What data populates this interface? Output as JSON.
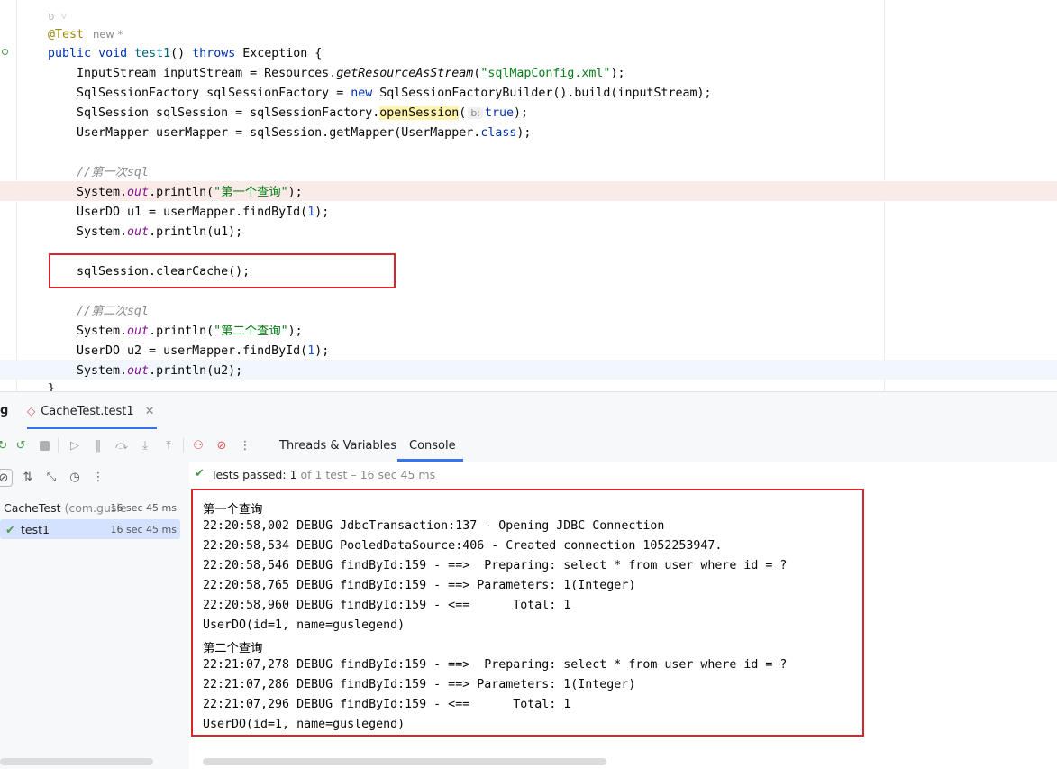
{
  "editor": {
    "author_hint": "ʋ",
    "annotation": "@Test",
    "annotation_meta": "new *",
    "lines": {
      "sig_kw1": "public",
      "sig_kw2": "void",
      "sig_name": "test1",
      "sig_rest": "() ",
      "sig_kw3": "throws",
      "sig_tail": " Exception {",
      "l1_a": "InputStream inputStream = Resources.",
      "l1_b": "getResourceAsStream",
      "l1_c": "(",
      "l1_d": "\"sqlMapConfig.xml\"",
      "l1_e": ");",
      "l2_a": "SqlSessionFactory sqlSessionFactory = ",
      "l2_b": "new",
      "l2_c": " SqlSessionFactoryBuilder().build(inputStream);",
      "l3_a": "SqlSession sqlSession = sqlSessionFactory.",
      "l3_b": "openSession",
      "l3_c": "(",
      "l3_hint": "b:",
      "l3_d": "true",
      "l3_e": ");",
      "l4_a": "UserMapper userMapper = sqlSession.getMapper(UserMapper.",
      "l4_b": "class",
      "l4_c": ");",
      "c1": "//第一次sql",
      "l5_a": "System.",
      "l5_b": "out",
      "l5_c": ".println(",
      "l5_d": "\"第一个查询\"",
      "l5_e": ");",
      "l6_a": "UserDO u1 = userMapper.findById(",
      "l6_b": "1",
      "l6_c": ");",
      "l7_a": "System.",
      "l7_b": "out",
      "l7_c": ".println(u1);",
      "l8": "sqlSession.clearCache();",
      "c2": "//第二次sql",
      "l9_a": "System.",
      "l9_b": "out",
      "l9_c": ".println(",
      "l9_d": "\"第二个查询\"",
      "l9_e": ");",
      "l10_a": "UserDO u2 = userMapper.findById(",
      "l10_b": "1",
      "l10_c": ");",
      "l11_a": "System.",
      "l11_b": "out",
      "l11_c": ".println(u2);",
      "close": "}"
    }
  },
  "debug_panel": {
    "tool_label": "g",
    "run_tab_label": "CacheTest.test1",
    "subtabs": [
      "Threads & Variables",
      "Console"
    ],
    "active_subtab": "Console",
    "status_text_prefix": "Tests passed: ",
    "status_count": "1",
    "status_suffix": " of 1 test – 16 sec 45 ms",
    "tree": [
      {
        "label": "CacheTest",
        "sub": "(com.gusle",
        "duration": "16 sec 45 ms"
      },
      {
        "label": "test1",
        "duration": "16 sec 45 ms"
      }
    ]
  },
  "console_lines": [
    "第一个查询",
    "22:20:58,002 DEBUG JdbcTransaction:137 - Opening JDBC Connection",
    "22:20:58,534 DEBUG PooledDataSource:406 - Created connection 1052253947.",
    "22:20:58,546 DEBUG findById:159 - ==>  Preparing: select * from user where id = ?",
    "22:20:58,765 DEBUG findById:159 - ==> Parameters: 1(Integer)",
    "22:20:58,960 DEBUG findById:159 - <==      Total: 1",
    "UserDO(id=1, name=guslegend)",
    "第二个查询",
    "22:21:07,278 DEBUG findById:159 - ==>  Preparing: select * from user where id = ?",
    "22:21:07,286 DEBUG findById:159 - ==> Parameters: 1(Integer)",
    "22:21:07,296 DEBUG findById:159 - <==      Total: 1",
    "UserDO(id=1, name=guslegend)"
  ],
  "colors": {
    "highlight_box": "#d9252b",
    "accent": "#3574f0",
    "pass_green": "#4a9a4a"
  }
}
